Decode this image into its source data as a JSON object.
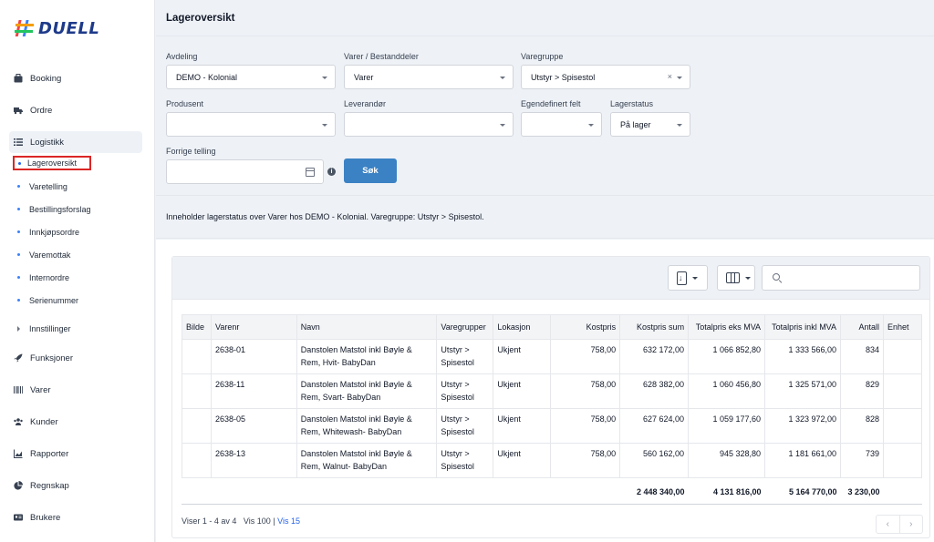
{
  "app": {
    "logo_text": "DUELL"
  },
  "sidebar": {
    "items": [
      {
        "label": "Booking",
        "icon": "briefcase-icon"
      },
      {
        "label": "Ordre",
        "icon": "truck-icon"
      },
      {
        "label": "Logistikk",
        "icon": "list-icon"
      }
    ],
    "sub_items": [
      {
        "label": "Lageroversikt"
      },
      {
        "label": "Varetelling"
      },
      {
        "label": "Bestillingsforslag"
      },
      {
        "label": "Innkjøpsordre"
      },
      {
        "label": "Varemottak"
      },
      {
        "label": "Internordre"
      },
      {
        "label": "Serienummer"
      },
      {
        "label": "Innstillinger"
      }
    ],
    "items_bottom": [
      {
        "label": "Funksjoner",
        "icon": "rocket-icon"
      },
      {
        "label": "Varer",
        "icon": "barcode-icon"
      },
      {
        "label": "Kunder",
        "icon": "users-icon"
      },
      {
        "label": "Rapporter",
        "icon": "chart-icon"
      },
      {
        "label": "Regnskap",
        "icon": "pie-chart-icon"
      },
      {
        "label": "Brukere",
        "icon": "id-card-icon"
      }
    ]
  },
  "header": {
    "title": "Lageroversikt"
  },
  "filters": {
    "avdeling": {
      "label": "Avdeling",
      "value": "DEMO - Kolonial"
    },
    "varer": {
      "label": "Varer / Bestanddeler",
      "value": "Varer"
    },
    "varegruppe": {
      "label": "Varegruppe",
      "value": "Utstyr > Spisestol",
      "clear": "×"
    },
    "produsent": {
      "label": "Produsent",
      "value": ""
    },
    "leverandor": {
      "label": "Leverandør",
      "value": ""
    },
    "egendefinert": {
      "label": "Egendefinert felt",
      "value": ""
    },
    "lagerstatus": {
      "label": "Lagerstatus",
      "value": "På lager"
    },
    "forrige": {
      "label": "Forrige telling",
      "value": ""
    },
    "info": "i",
    "search_button": "Søk"
  },
  "info_text": "Inneholder lagerstatus over Varer hos DEMO - Kolonial. Varegruppe: Utstyr > Spisestol.",
  "table": {
    "headers": [
      "Bilde",
      "Varenr",
      "Navn",
      "Varegrupper",
      "Lokasjon",
      "Kostpris",
      "Kostpris sum",
      "Totalpris eks MVA",
      "Totalpris inkl MVA",
      "Antall",
      "Enhet"
    ],
    "rows": [
      {
        "bilde": "",
        "varenr": "2638-01",
        "navn_1": "Danstolen Matstol inkl Bøyle &",
        "navn_2": "Rem, Hvit- BabyDan",
        "gruppe_1": "Utstyr >",
        "gruppe_2": "Spisestol",
        "lokasjon": "Ukjent",
        "kostpris": "758,00",
        "kostpris_sum": "632 172,00",
        "eks_mva": "1 066 852,80",
        "inkl_mva": "1 333 566,00",
        "antall": "834",
        "enhet": ""
      },
      {
        "bilde": "",
        "varenr": "2638-11",
        "navn_1": "Danstolen Matstol inkl Bøyle &",
        "navn_2": "Rem, Svart- BabyDan",
        "gruppe_1": "Utstyr >",
        "gruppe_2": "Spisestol",
        "lokasjon": "Ukjent",
        "kostpris": "758,00",
        "kostpris_sum": "628 382,00",
        "eks_mva": "1 060 456,80",
        "inkl_mva": "1 325 571,00",
        "antall": "829",
        "enhet": ""
      },
      {
        "bilde": "",
        "varenr": "2638-05",
        "navn_1": "Danstolen Matstol inkl Bøyle &",
        "navn_2": "Rem, Whitewash- BabyDan",
        "gruppe_1": "Utstyr >",
        "gruppe_2": "Spisestol",
        "lokasjon": "Ukjent",
        "kostpris": "758,00",
        "kostpris_sum": "627 624,00",
        "eks_mva": "1 059 177,60",
        "inkl_mva": "1 323 972,00",
        "antall": "828",
        "enhet": ""
      },
      {
        "bilde": "",
        "varenr": "2638-13",
        "navn_1": "Danstolen Matstol inkl Bøyle &",
        "navn_2": "Rem, Walnut- BabyDan",
        "gruppe_1": "Utstyr >",
        "gruppe_2": "Spisestol",
        "lokasjon": "Ukjent",
        "kostpris": "758,00",
        "kostpris_sum": "560 162,00",
        "eks_mva": "945 328,80",
        "inkl_mva": "1 181 661,00",
        "antall": "739",
        "enhet": ""
      }
    ],
    "totals": {
      "kostpris_sum": "2 448 340,00",
      "eks_mva": "4 131 816,00",
      "inkl_mva": "5 164 770,00",
      "antall": "3 230,00"
    }
  },
  "footer": {
    "showing": "Viser 1 - 4 av 4",
    "vis100": "Vis 100",
    "sep": "|",
    "vis15": "Vis 15",
    "prev": "‹",
    "next": "›"
  }
}
